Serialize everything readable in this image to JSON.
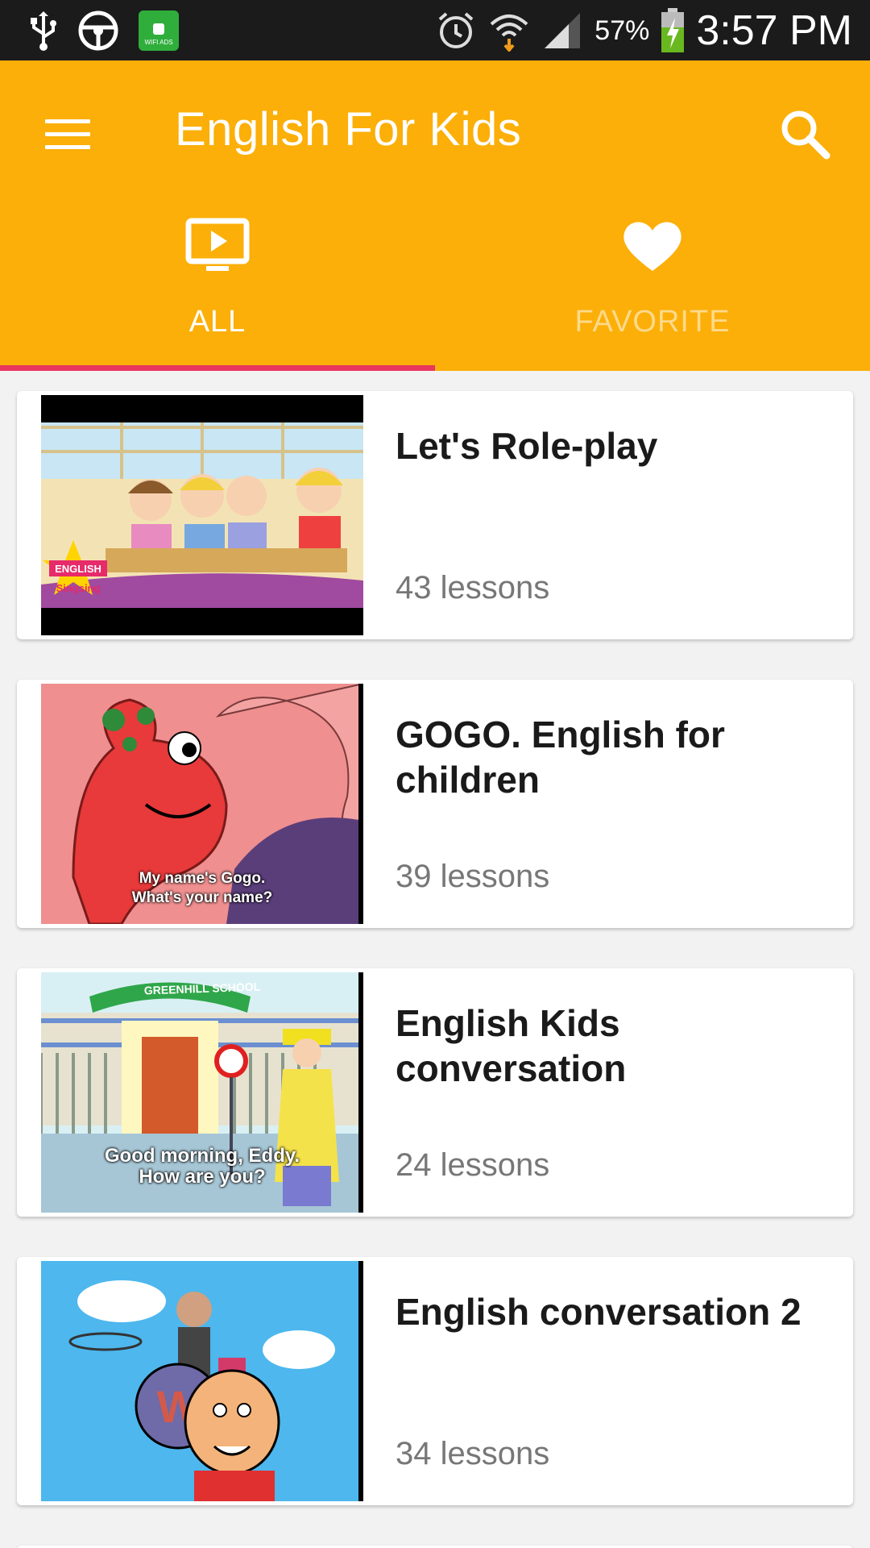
{
  "status_bar": {
    "time": "3:57 PM",
    "battery_percent": "57%",
    "wifi_ads_label": "WIFI ADS"
  },
  "app_bar": {
    "title": "English For Kids"
  },
  "tabs": [
    {
      "label": "ALL",
      "selected": true,
      "icon": "tv-play-icon"
    },
    {
      "label": "FAVORITE",
      "selected": false,
      "icon": "heart-icon"
    }
  ],
  "colors": {
    "primary": "#fbaf08",
    "indicator": "#e8365e",
    "status_bar": "#1b1b1b"
  },
  "playlists": [
    {
      "title": "Let's Role-play",
      "count": "43 lessons",
      "thumb_caption": "",
      "thumb_sign": "English Singsing"
    },
    {
      "title": "GOGO. English for children",
      "count": "39 lessons",
      "thumb_caption_1": "My name's Gogo.",
      "thumb_caption_2": "What's your name?"
    },
    {
      "title": "English Kids conversation",
      "count": "24 lessons",
      "thumb_sign": "GREENHILL SCHOOL",
      "thumb_caption_1": "Good morning, Eddy.",
      "thumb_caption_2": "How are you?"
    },
    {
      "title": "English conversation 2",
      "count": "34 lessons"
    }
  ]
}
